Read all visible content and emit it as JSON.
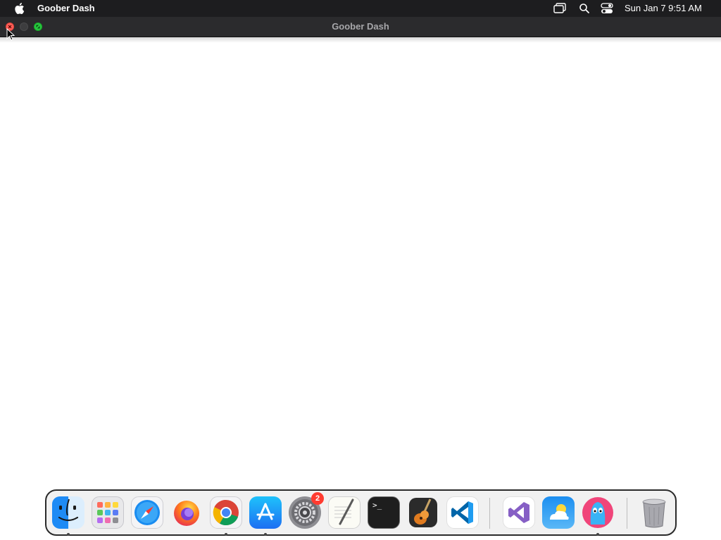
{
  "menubar": {
    "app_name": "Goober Dash",
    "clock": "Sun Jan 7  9:51 AM",
    "icons": [
      "apple-icon",
      "screen-mirroring-icon",
      "search-icon",
      "control-center-icon"
    ]
  },
  "window": {
    "title": "Goober Dash"
  },
  "colors": {
    "menubar": "#1d1d1f",
    "titlebar": "#2b2b2d",
    "close": "#ff5f57",
    "maximize": "#28c840"
  },
  "dock": {
    "items": [
      {
        "name": "Finder",
        "icon": "finder-icon"
      },
      {
        "name": "Launchpad",
        "icon": "launchpad-icon"
      },
      {
        "name": "Safari",
        "icon": "safari-icon"
      },
      {
        "name": "Firefox",
        "icon": "firefox-icon"
      },
      {
        "name": "Chrome",
        "icon": "chrome-icon"
      },
      {
        "name": "App Store",
        "icon": "app-store-icon"
      },
      {
        "name": "System Settings",
        "icon": "settings-icon",
        "badge": "2"
      },
      {
        "name": "TextEdit",
        "icon": "textedit-icon"
      },
      {
        "name": "Terminal",
        "icon": "terminal-icon",
        "glyph": ">_"
      },
      {
        "name": "GarageBand",
        "icon": "garageband-icon"
      },
      {
        "name": "Visual Studio Code",
        "icon": "vscode-icon"
      },
      {
        "name": "Visual Studio",
        "icon": "visual-studio-icon"
      },
      {
        "name": "Weather",
        "icon": "weather-icon"
      },
      {
        "name": "Goober Dash",
        "icon": "goober-dash-icon"
      },
      {
        "name": "Trash",
        "icon": "trash-icon"
      }
    ]
  }
}
